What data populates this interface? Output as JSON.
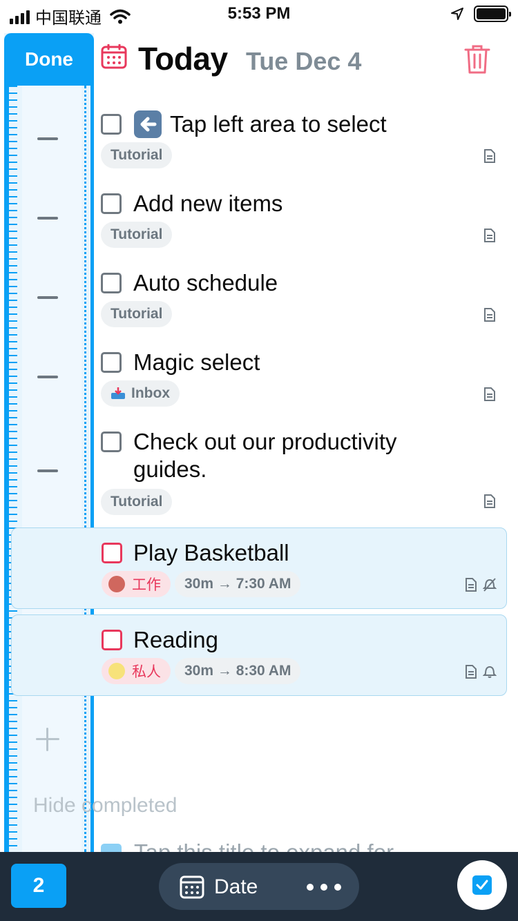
{
  "status_bar": {
    "carrier": "中国联通",
    "time": "5:53 PM"
  },
  "rail": {
    "done_label": "Done"
  },
  "header": {
    "title": "Today",
    "date": "Tue Dec 4"
  },
  "tasks": [
    {
      "title": "Tap left area to select",
      "tag": "Tutorial"
    },
    {
      "title": "Add new items",
      "tag": "Tutorial"
    },
    {
      "title": "Auto schedule",
      "tag": "Tutorial"
    },
    {
      "title": "Magic select",
      "tag": "Inbox"
    },
    {
      "title_line1": "Check out our productivity",
      "title_line2": "guides.",
      "tag": "Tutorial"
    },
    {
      "title": "Play Basketball",
      "tag": "工作",
      "tag_color": "#d0675e",
      "duration": "30m → 7:30 AM"
    },
    {
      "title": "Reading",
      "tag": "私人",
      "tag_color": "#f7e27a",
      "duration": "30m → 8:30 AM"
    }
  ],
  "hide_completed": "Hide completed",
  "ghost_title": "Tap this title to expand for",
  "bottom_bar": {
    "selected_count": "2",
    "date_label": "Date"
  },
  "colors": {
    "accent": "#0aa0f5",
    "danger": "#e8385c",
    "bar": "#1f2c3a"
  }
}
